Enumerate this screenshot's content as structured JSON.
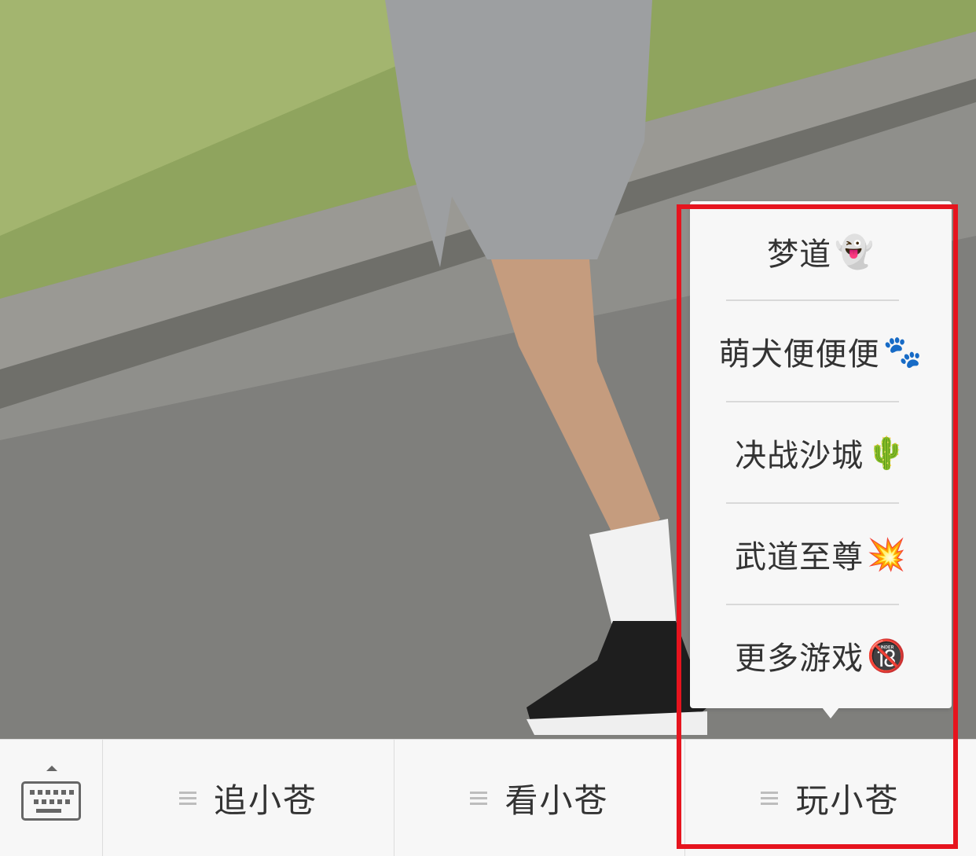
{
  "popup_menu": {
    "items": [
      {
        "label": "梦道",
        "emoji": "👻"
      },
      {
        "label": "萌犬便便便",
        "emoji": "🐾"
      },
      {
        "label": "决战沙城",
        "emoji": "🌵"
      },
      {
        "label": "武道至尊",
        "emoji": "💥"
      },
      {
        "label": "更多游戏",
        "emoji": "🔞"
      }
    ]
  },
  "bottom_bar": {
    "keyboard_icon": "keyboard-icon",
    "tabs": [
      {
        "label": "追小苍",
        "icon": "menu-icon"
      },
      {
        "label": "看小苍",
        "icon": "menu-icon"
      },
      {
        "label": "玩小苍",
        "icon": "menu-icon"
      }
    ]
  },
  "colors": {
    "highlight": "#e6141e",
    "bar_background": "#f7f7f7",
    "text": "#333333"
  }
}
